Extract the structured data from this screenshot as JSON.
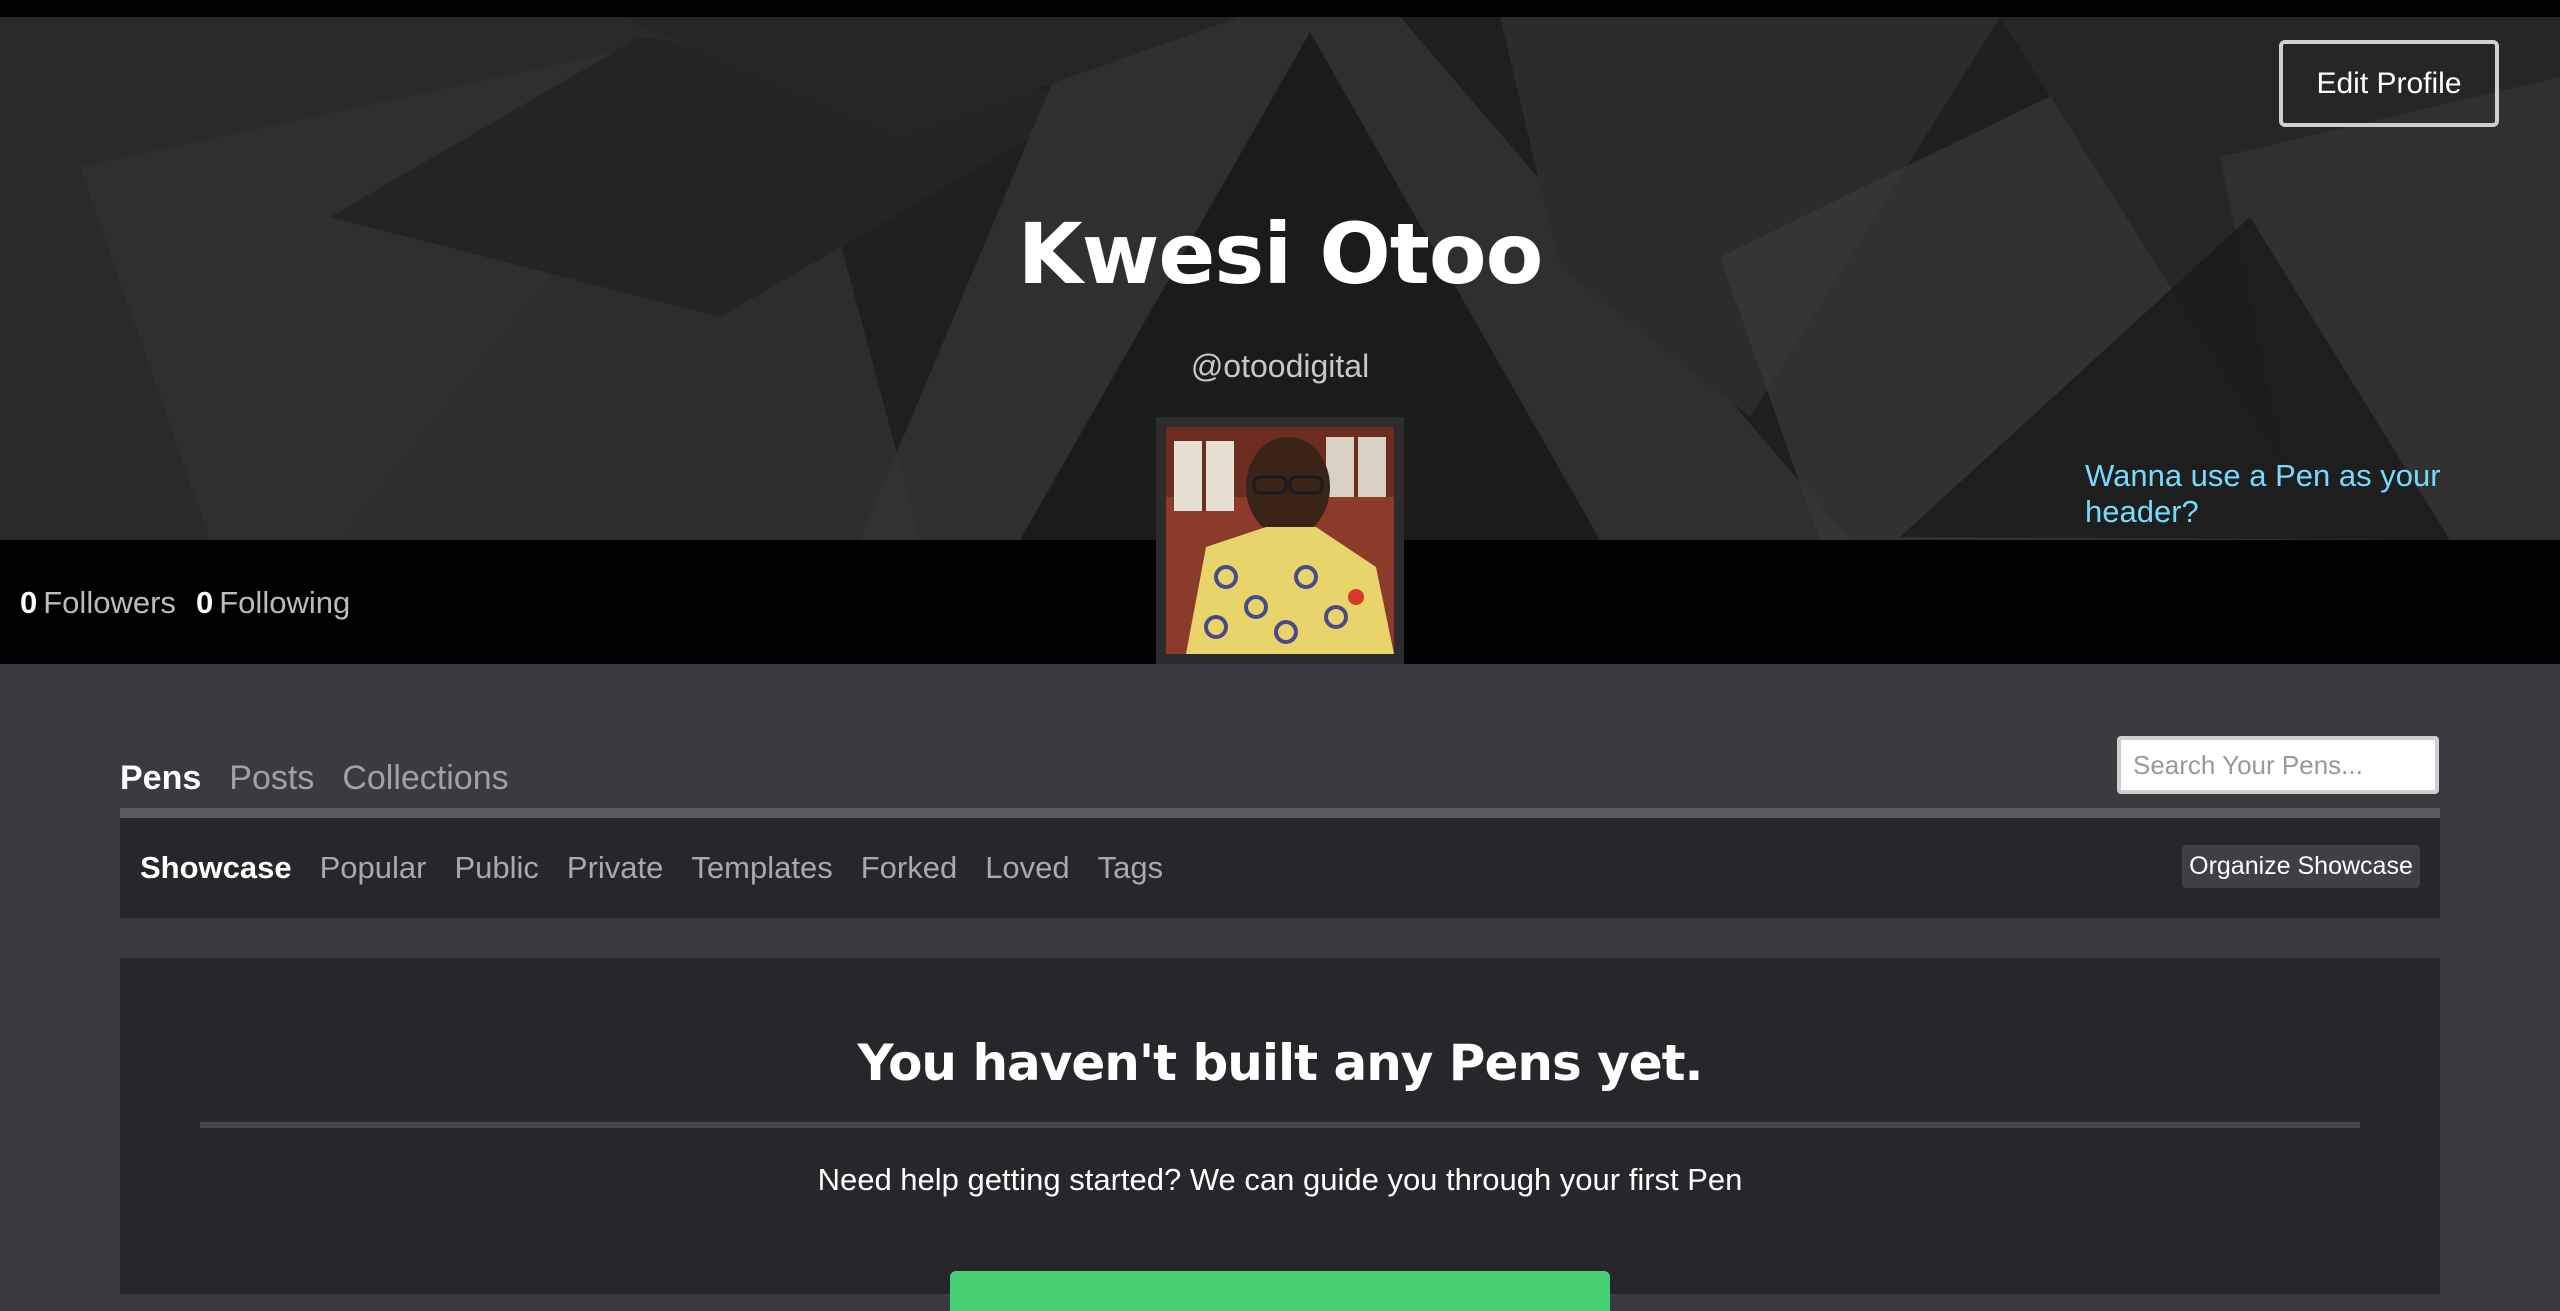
{
  "profile": {
    "name": "Kwesi Otoo",
    "handle": "@otoodigital",
    "edit_label": "Edit Profile",
    "header_pen_link": "Wanna use a Pen as your header?"
  },
  "stats": {
    "followers_count": "0",
    "followers_label": "Followers",
    "following_count": "0",
    "following_label": "Following"
  },
  "tabs": [
    {
      "label": "Pens",
      "active": true
    },
    {
      "label": "Posts",
      "active": false
    },
    {
      "label": "Collections",
      "active": false
    }
  ],
  "search": {
    "placeholder": "Search Your Pens..."
  },
  "subnav": {
    "items": [
      {
        "label": "Showcase",
        "active": true
      },
      {
        "label": "Popular"
      },
      {
        "label": "Public"
      },
      {
        "label": "Private"
      },
      {
        "label": "Templates"
      },
      {
        "label": "Forked"
      },
      {
        "label": "Loved"
      },
      {
        "label": "Tags"
      }
    ],
    "organize_label": "Organize Showcase"
  },
  "empty_state": {
    "title": "You haven't built any Pens yet.",
    "help": "Need help getting started? We can guide you through your first Pen"
  },
  "colors": {
    "accent_link": "#76daff",
    "cta_green": "#47cf73",
    "page_bg": "#3a3a41",
    "panel_bg": "#27272b"
  }
}
